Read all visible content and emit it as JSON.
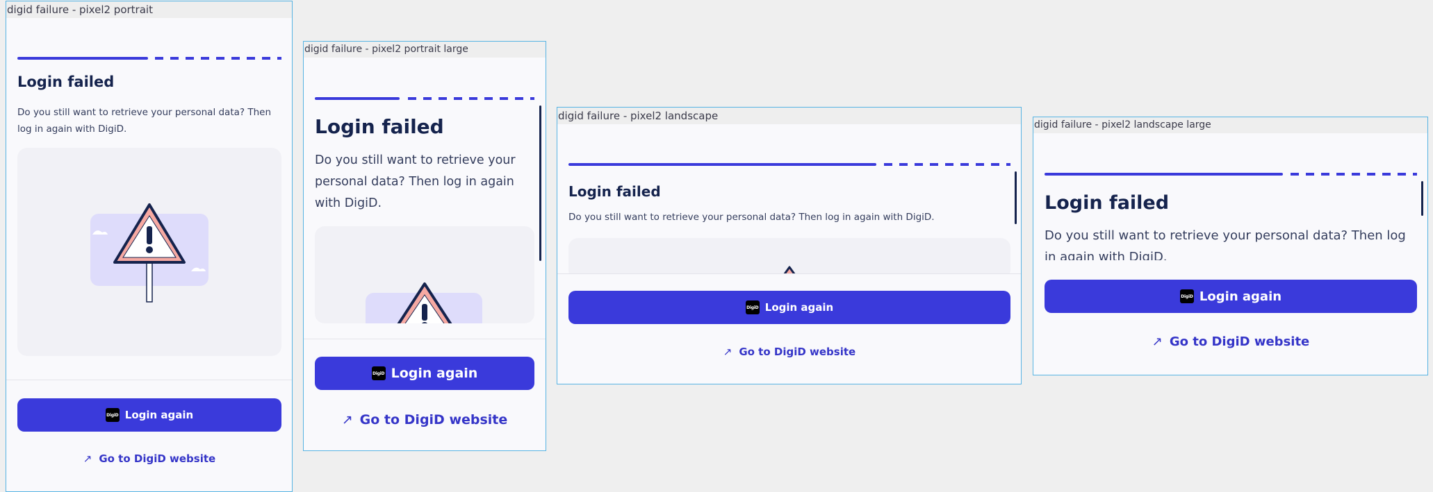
{
  "screens": [
    {
      "label": "digid  failure - pixel2  portrait",
      "title": "Login failed",
      "body": "Do you still want to retrieve your personal data? Then log in again with DigiD.",
      "primary_button": "Login again",
      "secondary_button": "Go to DigiD website",
      "logo_text": "DigiD"
    },
    {
      "label": "digid  failure - pixel2  portrait  large",
      "title": "Login failed",
      "body": "Do you still want to retrieve your personal data? Then log in again with DigiD.",
      "primary_button": "Login again",
      "secondary_button": "Go to DigiD website",
      "logo_text": "DigiD"
    },
    {
      "label": "digid  failure - pixel2  landscape",
      "title": "Login failed",
      "body": "Do you still want to retrieve your personal data? Then log in again with DigiD.",
      "primary_button": "Login again",
      "secondary_button": "Go to DigiD website",
      "logo_text": "DigiD"
    },
    {
      "label": "digid  failure - pixel2  landscape  large",
      "title": "Login failed",
      "body": "Do you still want to retrieve your personal data? Then log in again with DigiD.",
      "primary_button": "Login again",
      "secondary_button": "Go to DigiD website",
      "logo_text": "DigiD"
    }
  ],
  "icons": {
    "link_arrow": "external-link-arrow-icon",
    "warning": "warning-sign-icon",
    "logo": "digid-logo-icon"
  },
  "colors": {
    "accent": "#3a3adb",
    "title": "#15234d",
    "frame_border": "#56b3e3",
    "background": "#efefef"
  }
}
